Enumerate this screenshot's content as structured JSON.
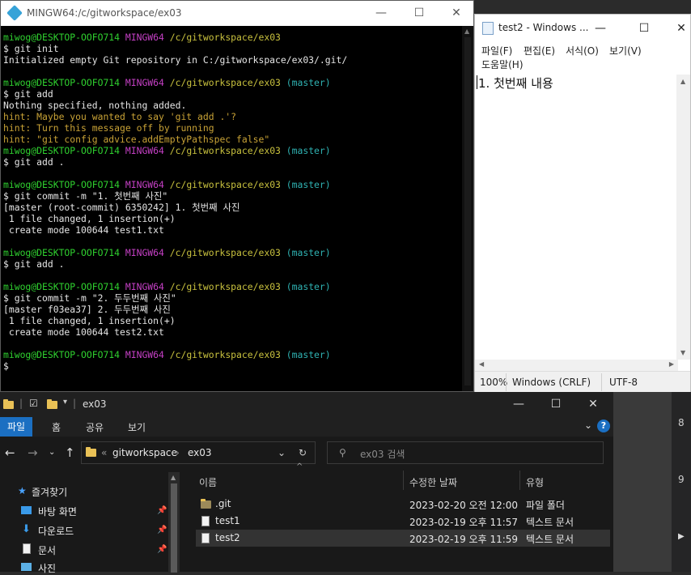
{
  "terminal": {
    "title": "MINGW64:/c/gitworkspace/ex03",
    "lines": [
      [
        {
          "t": "miwog@DESKTOP-OOFO714 ",
          "c": "c-green"
        },
        {
          "t": "MINGW64 ",
          "c": "c-mag"
        },
        {
          "t": "/c/gitworkspace/ex03",
          "c": "c-yel"
        }
      ],
      [
        {
          "t": "$ git init",
          "c": "c-white"
        }
      ],
      [
        {
          "t": "Initialized empty Git repository in C:/gitworkspace/ex03/.git/",
          "c": "c-white"
        }
      ],
      [
        {
          "t": "",
          "c": "c-white"
        }
      ],
      [
        {
          "t": "miwog@DESKTOP-OOFO714 ",
          "c": "c-green"
        },
        {
          "t": "MINGW64 ",
          "c": "c-mag"
        },
        {
          "t": "/c/gitworkspace/ex03 ",
          "c": "c-yel"
        },
        {
          "t": "(master)",
          "c": "c-cyan"
        }
      ],
      [
        {
          "t": "$ git add",
          "c": "c-white"
        }
      ],
      [
        {
          "t": "Nothing specified, nothing added.",
          "c": "c-white"
        }
      ],
      [
        {
          "t": "hint: Maybe you wanted to say 'git add .'?",
          "c": "c-hint"
        }
      ],
      [
        {
          "t": "hint: Turn this message off by running",
          "c": "c-hint"
        }
      ],
      [
        {
          "t": "hint: \"git config advice.addEmptyPathspec false\"",
          "c": "c-hint"
        }
      ],
      [
        {
          "t": "miwog@DESKTOP-OOFO714 ",
          "c": "c-green"
        },
        {
          "t": "MINGW64 ",
          "c": "c-mag"
        },
        {
          "t": "/c/gitworkspace/ex03 ",
          "c": "c-yel"
        },
        {
          "t": "(master)",
          "c": "c-cyan"
        }
      ],
      [
        {
          "t": "$ git add .",
          "c": "c-white"
        }
      ],
      [
        {
          "t": "",
          "c": "c-white"
        }
      ],
      [
        {
          "t": "miwog@DESKTOP-OOFO714 ",
          "c": "c-green"
        },
        {
          "t": "MINGW64 ",
          "c": "c-mag"
        },
        {
          "t": "/c/gitworkspace/ex03 ",
          "c": "c-yel"
        },
        {
          "t": "(master)",
          "c": "c-cyan"
        }
      ],
      [
        {
          "t": "$ git commit -m \"1. 첫번째 사진\"",
          "c": "c-white"
        }
      ],
      [
        {
          "t": "[master (root-commit) 6350242] 1. 첫번째 사진",
          "c": "c-white"
        }
      ],
      [
        {
          "t": " 1 file changed, 1 insertion(+)",
          "c": "c-white"
        }
      ],
      [
        {
          "t": " create mode 100644 test1.txt",
          "c": "c-white"
        }
      ],
      [
        {
          "t": "",
          "c": "c-white"
        }
      ],
      [
        {
          "t": "miwog@DESKTOP-OOFO714 ",
          "c": "c-green"
        },
        {
          "t": "MINGW64 ",
          "c": "c-mag"
        },
        {
          "t": "/c/gitworkspace/ex03 ",
          "c": "c-yel"
        },
        {
          "t": "(master)",
          "c": "c-cyan"
        }
      ],
      [
        {
          "t": "$ git add .",
          "c": "c-white"
        }
      ],
      [
        {
          "t": "",
          "c": "c-white"
        }
      ],
      [
        {
          "t": "miwog@DESKTOP-OOFO714 ",
          "c": "c-green"
        },
        {
          "t": "MINGW64 ",
          "c": "c-mag"
        },
        {
          "t": "/c/gitworkspace/ex03 ",
          "c": "c-yel"
        },
        {
          "t": "(master)",
          "c": "c-cyan"
        }
      ],
      [
        {
          "t": "$ git commit -m \"2. 두두번째 사진\"",
          "c": "c-white"
        }
      ],
      [
        {
          "t": "[master f03ea37] 2. 두두번째 사진",
          "c": "c-white"
        }
      ],
      [
        {
          "t": " 1 file changed, 1 insertion(+)",
          "c": "c-white"
        }
      ],
      [
        {
          "t": " create mode 100644 test2.txt",
          "c": "c-white"
        }
      ],
      [
        {
          "t": "",
          "c": "c-white"
        }
      ],
      [
        {
          "t": "miwog@DESKTOP-OOFO714 ",
          "c": "c-green"
        },
        {
          "t": "MINGW64 ",
          "c": "c-mag"
        },
        {
          "t": "/c/gitworkspace/ex03 ",
          "c": "c-yel"
        },
        {
          "t": "(master)",
          "c": "c-cyan"
        }
      ],
      [
        {
          "t": "$",
          "c": "c-white"
        }
      ]
    ]
  },
  "notepad": {
    "title": "test2 - Windows ...",
    "menu": [
      "파일(F)",
      "편집(E)",
      "서식(O)",
      "보기(V)",
      "도움말(H)"
    ],
    "content": "1. 첫번째 내용",
    "status": {
      "zoom": "100%",
      "eol": "Windows (CRLF)",
      "encoding": "UTF-8"
    }
  },
  "explorer": {
    "title": "ex03",
    "ribbon": [
      "파일",
      "홈",
      "공유",
      "보기"
    ],
    "address": [
      "gitworkspace",
      "ex03"
    ],
    "search_placeholder": "ex03 검색",
    "nav": [
      "즐겨찾기",
      "바탕 화면",
      "다운로드",
      "문서",
      "사진"
    ],
    "columns": [
      "이름",
      "수정한 날짜",
      "유형"
    ],
    "files": [
      {
        "name": ".git",
        "date": "2023-02-20 오전 12:00",
        "type": "파일 폴더",
        "icon": "folder-icon"
      },
      {
        "name": "test1",
        "date": "2023-02-19 오후 11:57",
        "type": "텍스트 문서",
        "icon": "text-file-icon"
      },
      {
        "name": "test2",
        "date": "2023-02-19 오후 11:59",
        "type": "텍스트 문서",
        "icon": "text-file-icon"
      }
    ]
  },
  "background": {
    "numbers": [
      "8",
      "9"
    ]
  }
}
